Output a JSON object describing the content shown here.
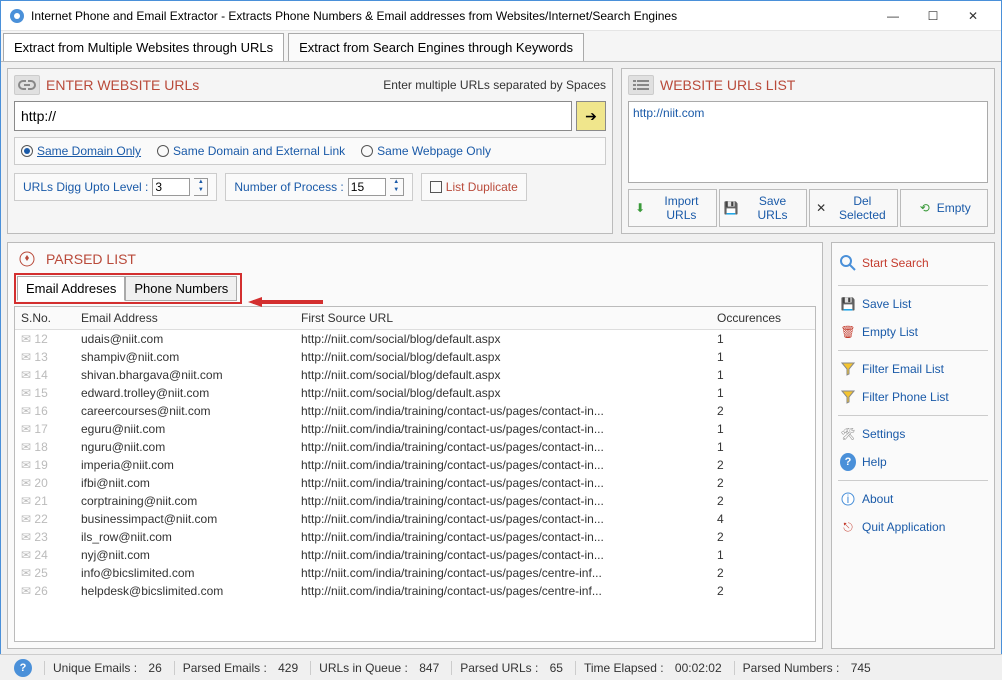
{
  "window": {
    "title": "Internet Phone and Email Extractor - Extracts Phone Numbers & Email addresses from Websites/Internet/Search Engines"
  },
  "main_tabs": {
    "tab1": "Extract from Multiple Websites through URLs",
    "tab2": "Extract from Search Engines through Keywords"
  },
  "enter_urls": {
    "header": "ENTER WEBSITE URLs",
    "subtitle": "Enter multiple URLs separated by Spaces",
    "url_value": "http://",
    "radio1": "Same Domain Only",
    "radio2": "Same Domain and External Link",
    "radio3": "Same Webpage Only",
    "digg_label": "URLs Digg Upto Level :",
    "digg_value": "3",
    "proc_label": "Number of Process :",
    "proc_value": "15",
    "list_dup": "List Duplicate"
  },
  "urls_list": {
    "header": "WEBSITE URLs LIST",
    "item1": "http://niit.com",
    "btn_import": "Import URLs",
    "btn_save": "Save URLs",
    "btn_del": "Del Selected",
    "btn_empty": "Empty"
  },
  "parsed": {
    "header": "PARSED LIST",
    "tab_email": "Email Addreses",
    "tab_phone": "Phone Numbers",
    "col_sno": "S.No.",
    "col_email": "Email Address",
    "col_url": "First Source URL",
    "col_occ": "Occurences",
    "rows": [
      {
        "sno": "12",
        "email": "udais@niit.com",
        "url": "http://niit.com/social/blog/default.aspx",
        "occ": "1"
      },
      {
        "sno": "13",
        "email": "shampiv@niit.com",
        "url": "http://niit.com/social/blog/default.aspx",
        "occ": "1"
      },
      {
        "sno": "14",
        "email": "shivan.bhargava@niit.com",
        "url": "http://niit.com/social/blog/default.aspx",
        "occ": "1"
      },
      {
        "sno": "15",
        "email": "edward.trolley@niit.com",
        "url": "http://niit.com/social/blog/default.aspx",
        "occ": "1"
      },
      {
        "sno": "16",
        "email": "careercourses@niit.com",
        "url": "http://niit.com/india/training/contact-us/pages/contact-in...",
        "occ": "2"
      },
      {
        "sno": "17",
        "email": "eguru@niit.com",
        "url": "http://niit.com/india/training/contact-us/pages/contact-in...",
        "occ": "1"
      },
      {
        "sno": "18",
        "email": "nguru@niit.com",
        "url": "http://niit.com/india/training/contact-us/pages/contact-in...",
        "occ": "1"
      },
      {
        "sno": "19",
        "email": "imperia@niit.com",
        "url": "http://niit.com/india/training/contact-us/pages/contact-in...",
        "occ": "2"
      },
      {
        "sno": "20",
        "email": "ifbi@niit.com",
        "url": "http://niit.com/india/training/contact-us/pages/contact-in...",
        "occ": "2"
      },
      {
        "sno": "21",
        "email": "corptraining@niit.com",
        "url": "http://niit.com/india/training/contact-us/pages/contact-in...",
        "occ": "2"
      },
      {
        "sno": "22",
        "email": "businessimpact@niit.com",
        "url": "http://niit.com/india/training/contact-us/pages/contact-in...",
        "occ": "4"
      },
      {
        "sno": "23",
        "email": "ils_row@niit.com",
        "url": "http://niit.com/india/training/contact-us/pages/contact-in...",
        "occ": "2"
      },
      {
        "sno": "24",
        "email": "nyj@niit.com",
        "url": "http://niit.com/india/training/contact-us/pages/contact-in...",
        "occ": "1"
      },
      {
        "sno": "25",
        "email": "info@bicslimited.com",
        "url": "http://niit.com/india/training/contact-us/pages/centre-inf...",
        "occ": "2"
      },
      {
        "sno": "26",
        "email": "helpdesk@bicslimited.com",
        "url": "http://niit.com/india/training/contact-us/pages/centre-inf...",
        "occ": "2"
      }
    ]
  },
  "side": {
    "start": "Start Search",
    "save": "Save List",
    "empty": "Empty List",
    "filter_email": "Filter Email List",
    "filter_phone": "Filter Phone List",
    "settings": "Settings",
    "help": "Help",
    "about": "About",
    "quit": "Quit Application"
  },
  "status": {
    "unique_emails_label": "Unique Emails :",
    "unique_emails_val": "26",
    "parsed_emails_label": "Parsed Emails :",
    "parsed_emails_val": "429",
    "queue_label": "URLs in Queue :",
    "queue_val": "847",
    "parsed_urls_label": "Parsed URLs :",
    "parsed_urls_val": "65",
    "elapsed_label": "Time Elapsed :",
    "elapsed_val": "00:02:02",
    "parsed_num_label": "Parsed Numbers :",
    "parsed_num_val": "745"
  }
}
